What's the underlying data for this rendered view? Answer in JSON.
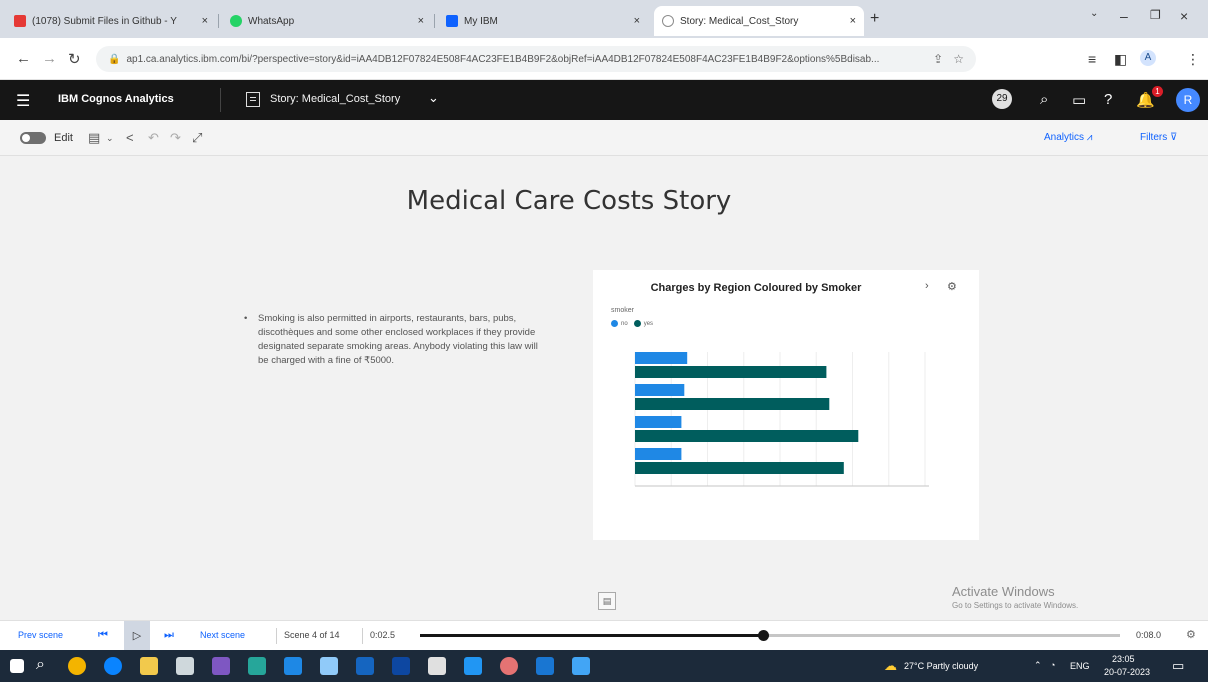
{
  "browser": {
    "tabs": [
      {
        "label": "(1078) Submit Files in Github - Y",
        "favicon_color": "#e53935"
      },
      {
        "label": "WhatsApp",
        "favicon_color": "#25d366"
      },
      {
        "label": "My IBM",
        "favicon_color": "#0f62fe"
      },
      {
        "label": "Story: Medical_Cost_Story",
        "favicon_color": "#8c8c8c"
      }
    ],
    "close_glyph": "×",
    "new_tab": "+",
    "url": "ap1.ca.analytics.ibm.com/bi/?perspective=story&id=iAA4DB12F07824E508F4AC23FE1B4B9F2&objRef=iAA4DB12F07824E508F4AC23FE1B4B9F2&options%5Bdisab..."
  },
  "app": {
    "brand": "IBM Cognos Analytics",
    "story_title": "Story: Medical_Cost_Story",
    "notification_count": "1",
    "avatar_initial": "R",
    "circle_badge": "29"
  },
  "toolbar": {
    "edit_label": "Edit",
    "analytics_label": "Analytics",
    "filters_label": "Filters"
  },
  "scene": {
    "heading": "Medical Care Costs Story",
    "bullet": "Smoking is also permitted in airports, restaurants, bars, pubs, discothèques and some other enclosed workplaces if they provide designated separate smoking areas. Anybody violating this law will be charged with a fine of ₹5000."
  },
  "chart_data": {
    "type": "bar",
    "orientation": "horizontal",
    "title": "Charges by Region Coloured by Smoker",
    "legend_title": "smoker",
    "legend_position": "top-left",
    "categories": [
      "",
      "",
      "",
      ""
    ],
    "series": [
      {
        "name": "no",
        "color": "#1f88e5",
        "values": [
          0.18,
          0.17,
          0.16,
          0.16
        ]
      },
      {
        "name": "yes",
        "color": "#005d5d",
        "values": [
          0.66,
          0.67,
          0.77,
          0.72
        ]
      }
    ],
    "xlim": [
      0,
      1
    ],
    "grid": true
  },
  "playback": {
    "prev_label": "Prev scene",
    "next_label": "Next scene",
    "scene_counter": "Scene 4 of 14",
    "elapsed": "0:02.5",
    "total": "0:08.0",
    "progress": 0.49
  },
  "watermark": {
    "line1": "Activate Windows",
    "line2": "Go to Settings to activate Windows."
  },
  "taskbar": {
    "weather": "27°C Partly cloudy",
    "language": "ENG",
    "time": "23:05",
    "date": "20-07-2023"
  }
}
